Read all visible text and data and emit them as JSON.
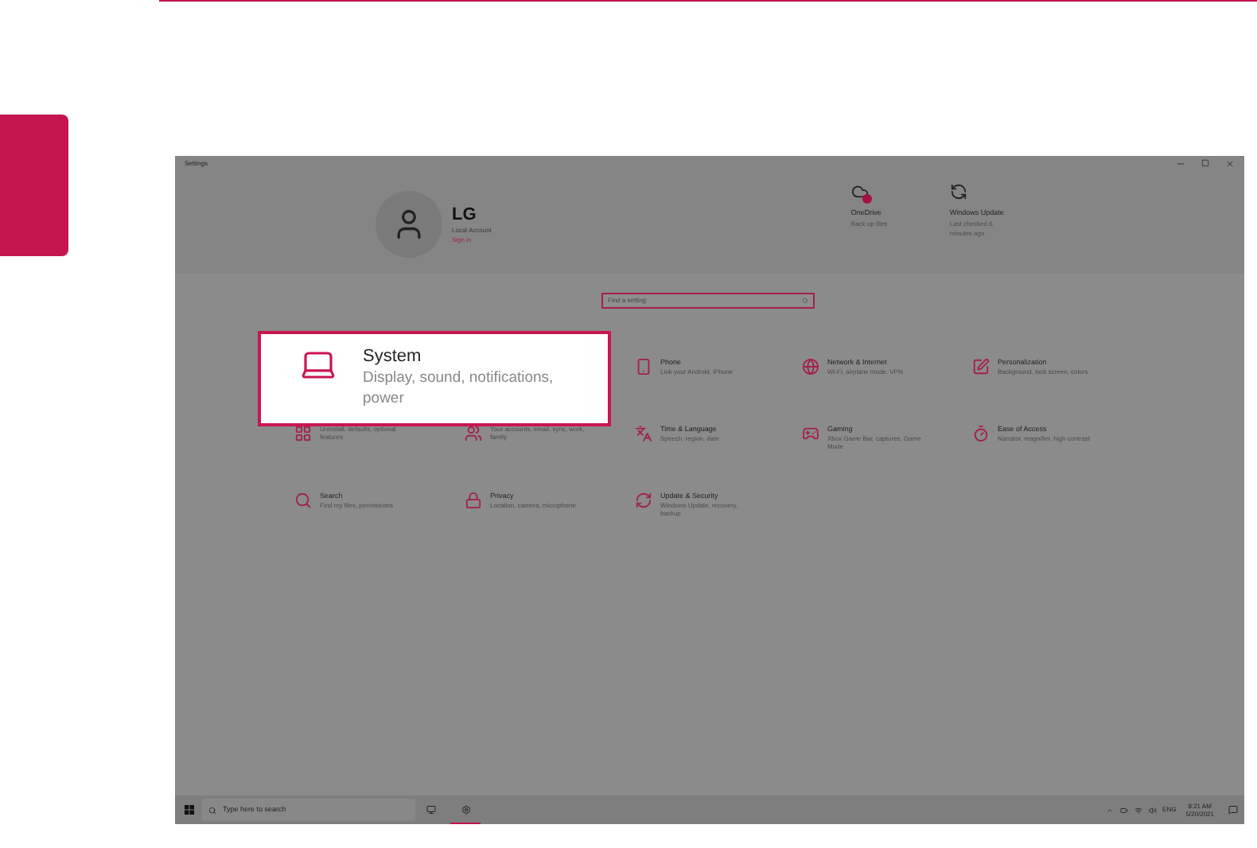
{
  "window": {
    "title": "Settings"
  },
  "account": {
    "name": "LG",
    "type": "Local Account",
    "link": "Sign in"
  },
  "quick_links": [
    {
      "title": "OneDrive",
      "subtitle": "Back up files",
      "alert": true
    },
    {
      "title": "Windows Update",
      "subtitle": "Last checked 6 minutes ago",
      "alert": false
    }
  ],
  "search": {
    "placeholder": "Find a setting"
  },
  "highlight": {
    "title": "System",
    "description": "Display, sound, notifications, power"
  },
  "categories": [
    {
      "kind": "hidden"
    },
    {
      "kind": "hidden"
    },
    {
      "kind": "phone",
      "title": "Phone",
      "description": "Link your Android, iPhone"
    },
    {
      "kind": "network",
      "title": "Network & Internet",
      "description": "Wi-Fi, airplane mode, VPN"
    },
    {
      "kind": "personalization",
      "title": "Personalization",
      "description": "Background, lock screen, colors"
    },
    {
      "kind": "apps",
      "description": "Uninstall, defaults, optional features"
    },
    {
      "kind": "accounts",
      "description": "Your accounts, email, sync, work, family"
    },
    {
      "kind": "time",
      "title": "Time & Language",
      "description": "Speech, region, date"
    },
    {
      "kind": "gaming",
      "title": "Gaming",
      "description": "Xbox Game Bar, captures, Game Mode"
    },
    {
      "kind": "ease",
      "title": "Ease of Access",
      "description": "Narrator, magnifier, high contrast"
    },
    {
      "kind": "search",
      "title": "Search",
      "description": "Find my files, permissions"
    },
    {
      "kind": "privacy",
      "title": "Privacy",
      "description": "Location, camera, microphone"
    },
    {
      "kind": "update",
      "title": "Update & Security",
      "description": "Windows Update, recovery, backup"
    }
  ],
  "taskbar": {
    "search_placeholder": "Type here to search",
    "language": "ENG",
    "time": "8:21 AM",
    "date": "5/20/2021"
  }
}
